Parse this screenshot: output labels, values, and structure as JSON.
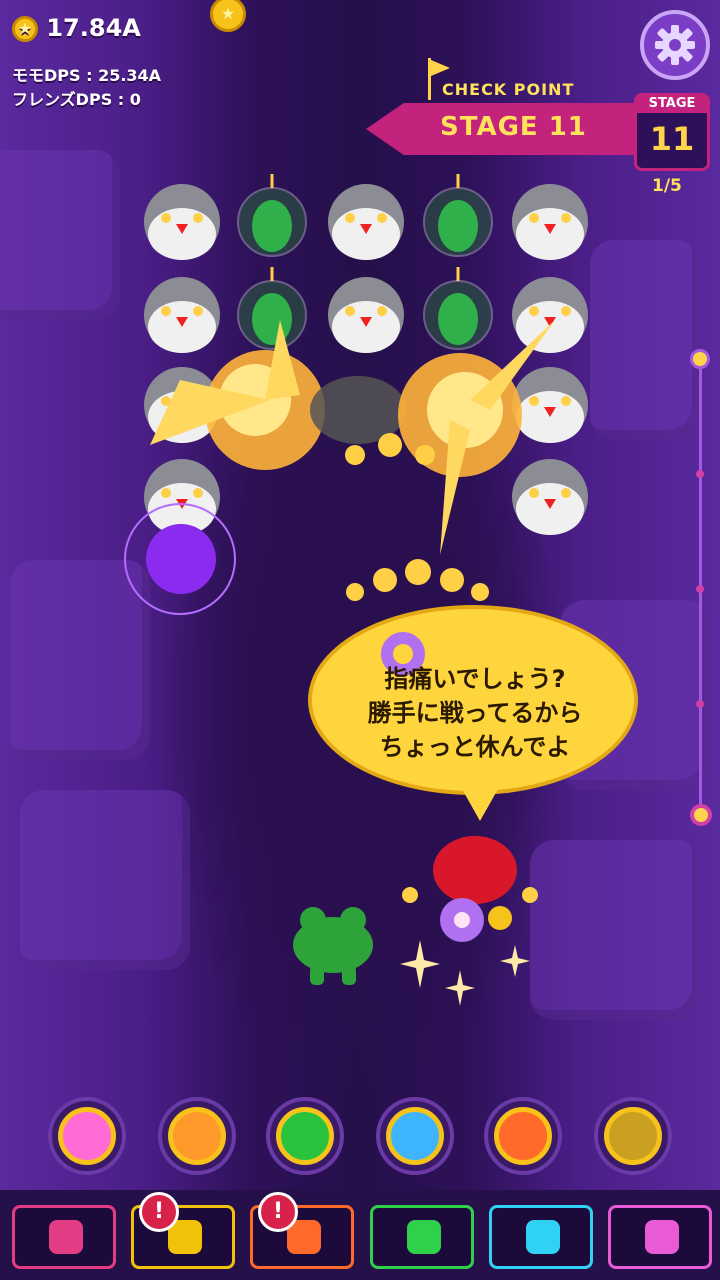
{
  "hud": {
    "coins": "17.84A",
    "momo_dps": "モモDPS : 25.34A",
    "friends_dps": "フレンズDPS : 0"
  },
  "checkpoint": {
    "label": "CHECK POINT",
    "stage_title": "STAGE 11"
  },
  "stage_box": {
    "label": "STAGE",
    "number": "11",
    "progress": "1/5"
  },
  "speech": {
    "lines": [
      "指痛いでしょう?",
      "勝手に戦ってるから",
      "ちょっと休んでよ"
    ]
  },
  "skills": [
    {
      "name": "rainbow-skill",
      "color": "#ff6ad5"
    },
    {
      "name": "bullet-orange-skill",
      "color": "#ff9a2a"
    },
    {
      "name": "target-skill",
      "color": "#29c23d"
    },
    {
      "name": "bullet-blue-skill",
      "color": "#3fb4ff"
    },
    {
      "name": "monster-skill",
      "color": "#ff6a2a"
    },
    {
      "name": "coin-skill",
      "color": "#c9a020"
    }
  ],
  "menu": [
    {
      "name": "upgrade-menu-button",
      "color": "#e23c84",
      "alert": false
    },
    {
      "name": "sun-menu-button",
      "color": "#f2c10a",
      "alert": true
    },
    {
      "name": "bomb-menu-button",
      "color": "#ff6a2a",
      "alert": true
    },
    {
      "name": "explosion-menu-button",
      "color": "#2fd14b",
      "alert": false
    },
    {
      "name": "scroll-menu-button",
      "color": "#2fd2f2",
      "alert": false
    },
    {
      "name": "gem-shop-button",
      "color": "#e85ad6",
      "alert": false
    }
  ],
  "colors": {
    "accent": "#c4237d",
    "gold": "#ffd34a"
  }
}
